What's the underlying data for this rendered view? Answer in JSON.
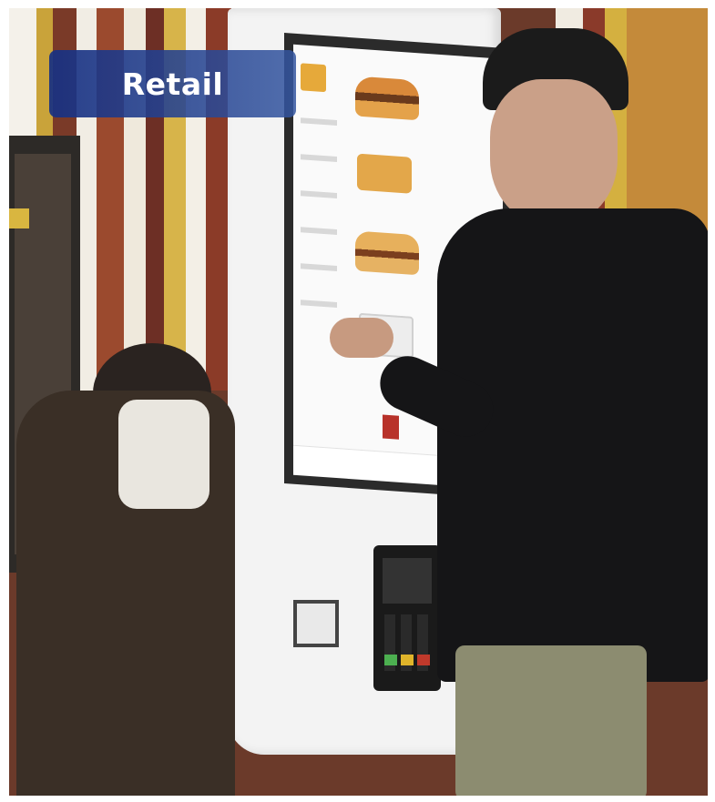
{
  "badge": {
    "label": "Retail"
  },
  "colors": {
    "badge_bg": "#1f3a8a",
    "kiosk_body": "#f2f2f2",
    "accent_green": "#3cb043"
  },
  "icons": [
    "kiosk-screen",
    "card-reader",
    "person"
  ]
}
